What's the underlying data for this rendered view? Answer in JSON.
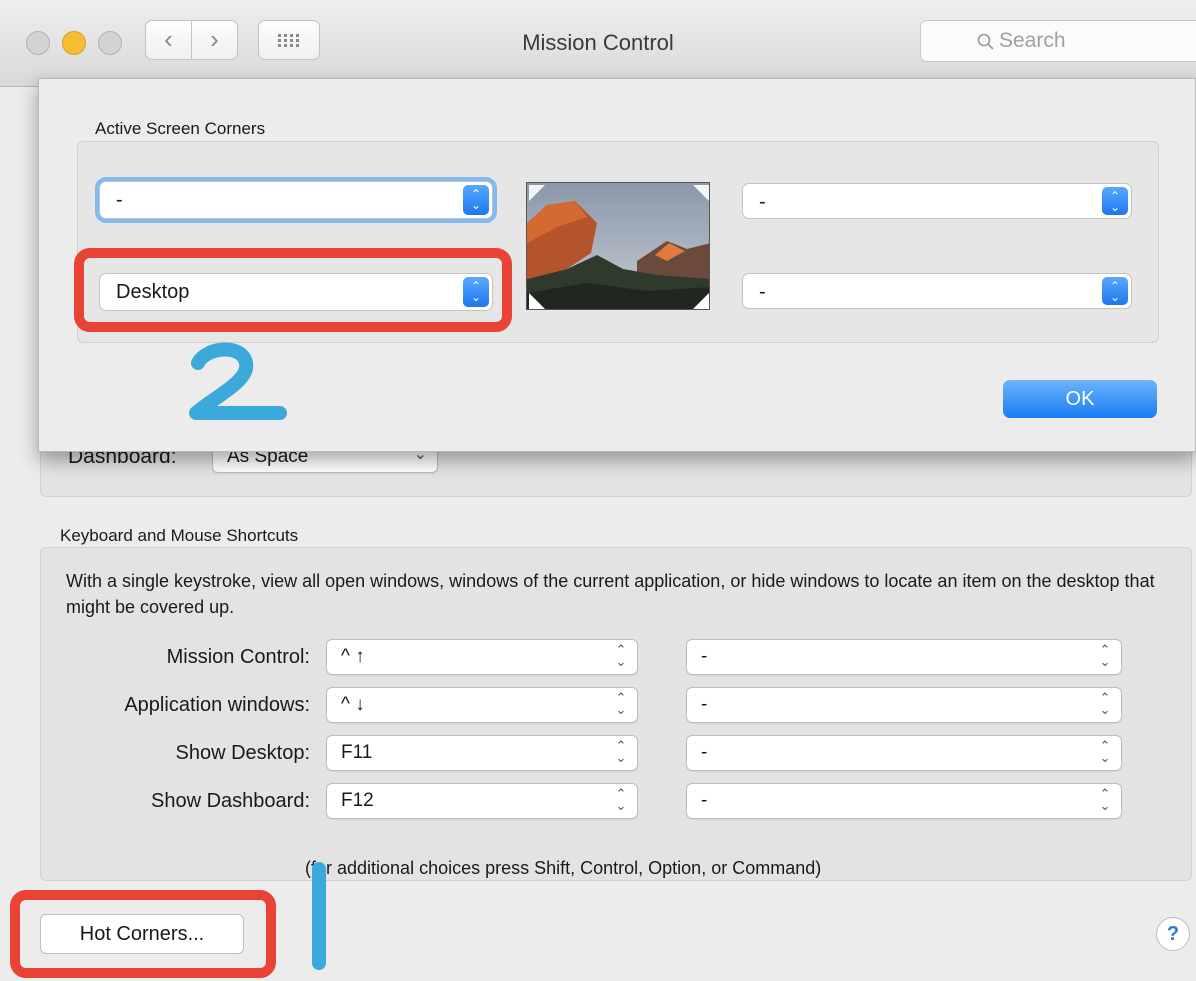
{
  "window": {
    "title": "Mission Control"
  },
  "toolbar": {
    "back_glyph": "‹",
    "forward_glyph": "›",
    "grid_glyph": "⁞⁞⁞",
    "search_placeholder": "Search"
  },
  "background": {
    "dashboard_label": "Dashboard:",
    "dashboard_value": "As Space"
  },
  "shortcuts": {
    "section_label": "Keyboard and Mouse Shortcuts",
    "description": "With a single keystroke, view all open windows, windows of the current application, or hide windows to locate an item on the desktop that might be covered up.",
    "rows": [
      {
        "label": "Mission Control:",
        "key": "^ ↑",
        "modifier": "-"
      },
      {
        "label": "Application windows:",
        "key": "^ ↓",
        "modifier": "-"
      },
      {
        "label": "Show Desktop:",
        "key": "F11",
        "modifier": "-"
      },
      {
        "label": "Show Dashboard:",
        "key": "F12",
        "modifier": "-"
      }
    ],
    "footnote": "(for additional choices press Shift, Control, Option, or Command)"
  },
  "hot_corners_button": "Hot Corners...",
  "help_glyph": "?",
  "sheet": {
    "section_label": "Active Screen Corners",
    "top_left": "-",
    "bottom_left": "Desktop",
    "top_right": "-",
    "bottom_right": "-",
    "ok_label": "OK"
  },
  "annotations": {
    "step_one": "1",
    "step_two": "2",
    "color": "#ea4335",
    "marker_color": "#3ba9d9"
  },
  "colors": {
    "accent": "#1b7cf1",
    "close": "#c9c9c9",
    "minimize": "#f5bd30",
    "zoom": "#c9c9c9"
  }
}
